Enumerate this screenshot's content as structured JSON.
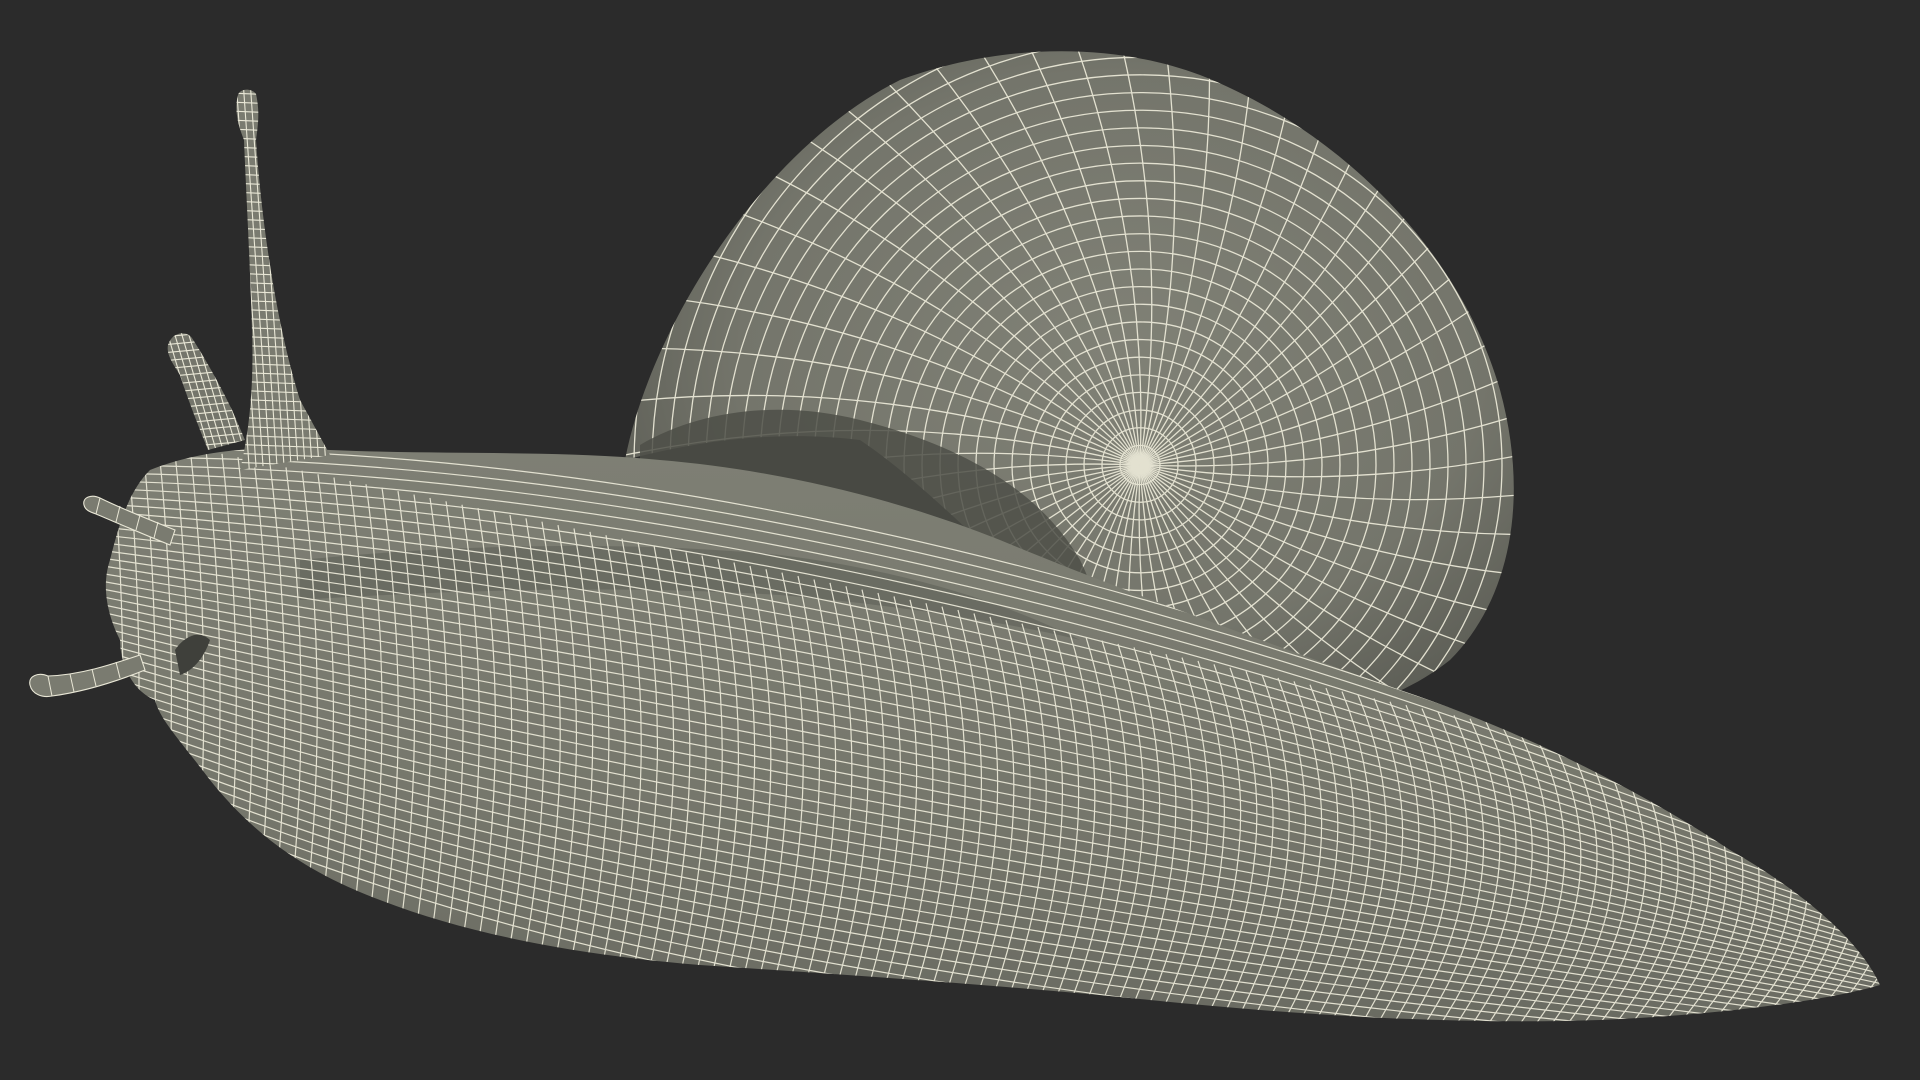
{
  "scene": {
    "subject": "snail-wireframe-render",
    "colors": {
      "background": "#2b2b2b",
      "surface": "#7a7b70",
      "surface_shadow": "#5f6058",
      "surface_dark": "#4a4b45",
      "wire": "#e9e7d6"
    }
  }
}
